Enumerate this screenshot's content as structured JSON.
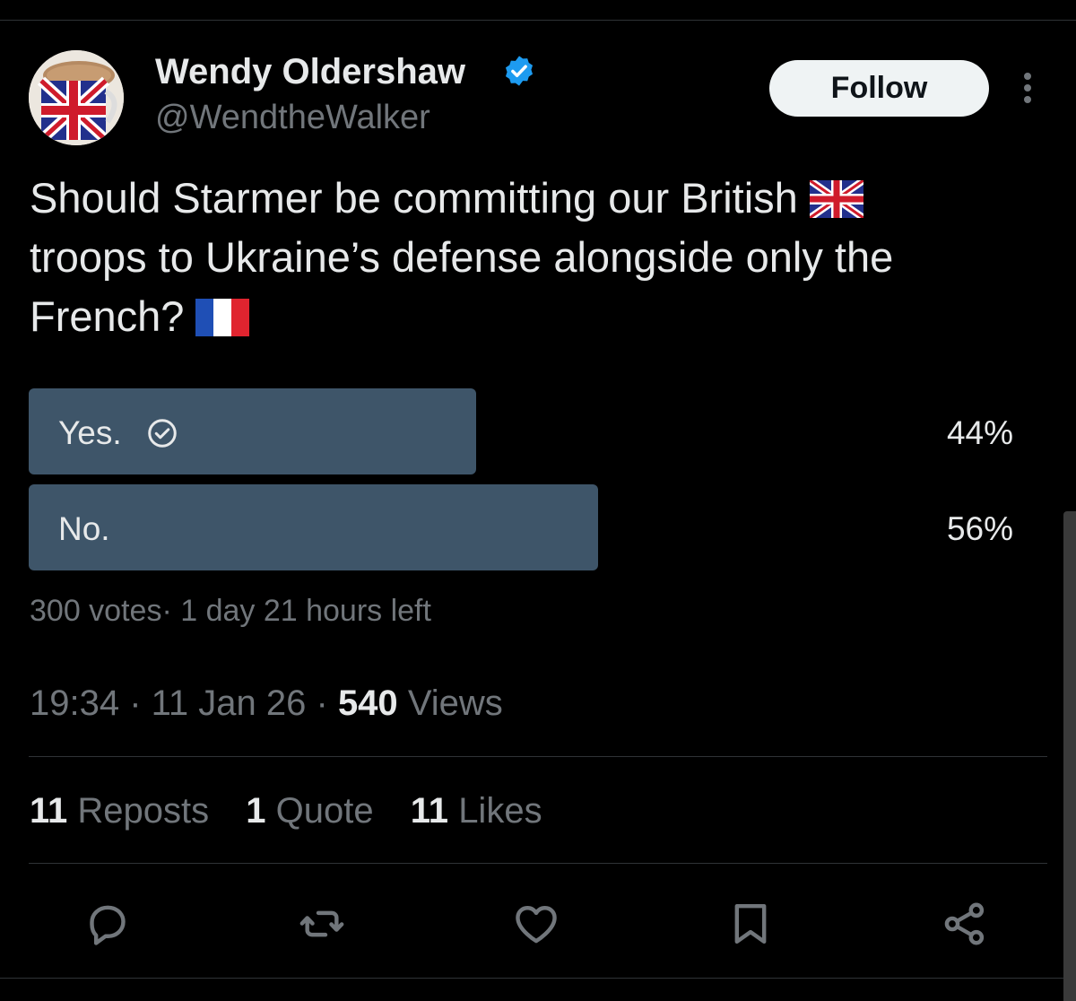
{
  "author": {
    "name": "Wendy Oldershaw",
    "handle": "@WendtheWalker",
    "follow_label": "Follow"
  },
  "tweet": {
    "text_line1": "Should Starmer be committing our British",
    "text_line2": "troops to Ukraine’s defense alongside only the",
    "text_line3": "French?"
  },
  "poll": {
    "options": [
      {
        "label": "Yes.",
        "percent_label": "44%",
        "share": 0.44,
        "selected": true
      },
      {
        "label": "No.",
        "percent_label": "56%",
        "share": 0.56,
        "selected": false
      }
    ],
    "meta": "300 votes· 1 day 21 hours left"
  },
  "timestamp": {
    "time": "19:34",
    "date": "11 Jan 26",
    "views_count": "540",
    "views_label": "Views"
  },
  "stats": {
    "reposts_count": "11",
    "reposts_label": "Reposts",
    "quotes_count": "1",
    "quotes_label": "Quote",
    "likes_count": "11",
    "likes_label": "Likes"
  },
  "colors": {
    "background": "#000000",
    "poll_bar": "#3e5569",
    "verified": "#1d9bf0",
    "muted_text": "#71767b"
  },
  "icons": [
    "verified-badge-icon",
    "more-icon",
    "check-circle-icon",
    "reply-icon",
    "repost-icon",
    "like-icon",
    "bookmark-icon",
    "share-icon",
    "union-jack-flag",
    "french-flag"
  ]
}
